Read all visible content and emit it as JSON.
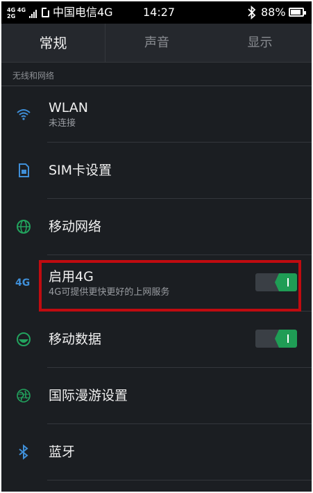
{
  "status_bar": {
    "net_top": "4G 4G",
    "net_bottom": "2G",
    "carrier": "中国电信4G",
    "time": "14:27",
    "battery": "88%"
  },
  "tabs": [
    {
      "label": "常规",
      "active": true
    },
    {
      "label": "声音",
      "active": false
    },
    {
      "label": "显示",
      "active": false
    }
  ],
  "section_header": "无线和网络",
  "rows": [
    {
      "title": "WLAN",
      "subtitle": "未连接",
      "icon": "wifi-icon"
    },
    {
      "title": "SIM卡设置",
      "icon": "sim-card-icon"
    },
    {
      "title": "移动网络",
      "icon": "globe-icon"
    },
    {
      "title": "启用4G",
      "subtitle": "4G可提供更快更好的上网服务",
      "icon_label": "4G",
      "toggle": true
    },
    {
      "title": "移动数据",
      "icon": "mobile-data-icon",
      "toggle": true
    },
    {
      "title": "国际漫游设置",
      "icon": "roaming-globe-icon"
    },
    {
      "title": "蓝牙",
      "icon": "bluetooth-icon"
    }
  ],
  "colors": {
    "accent_blue": "#3f8fd8",
    "accent_green": "#1f9d55",
    "highlight_red": "#c00b10",
    "background": "#1b1e22"
  }
}
